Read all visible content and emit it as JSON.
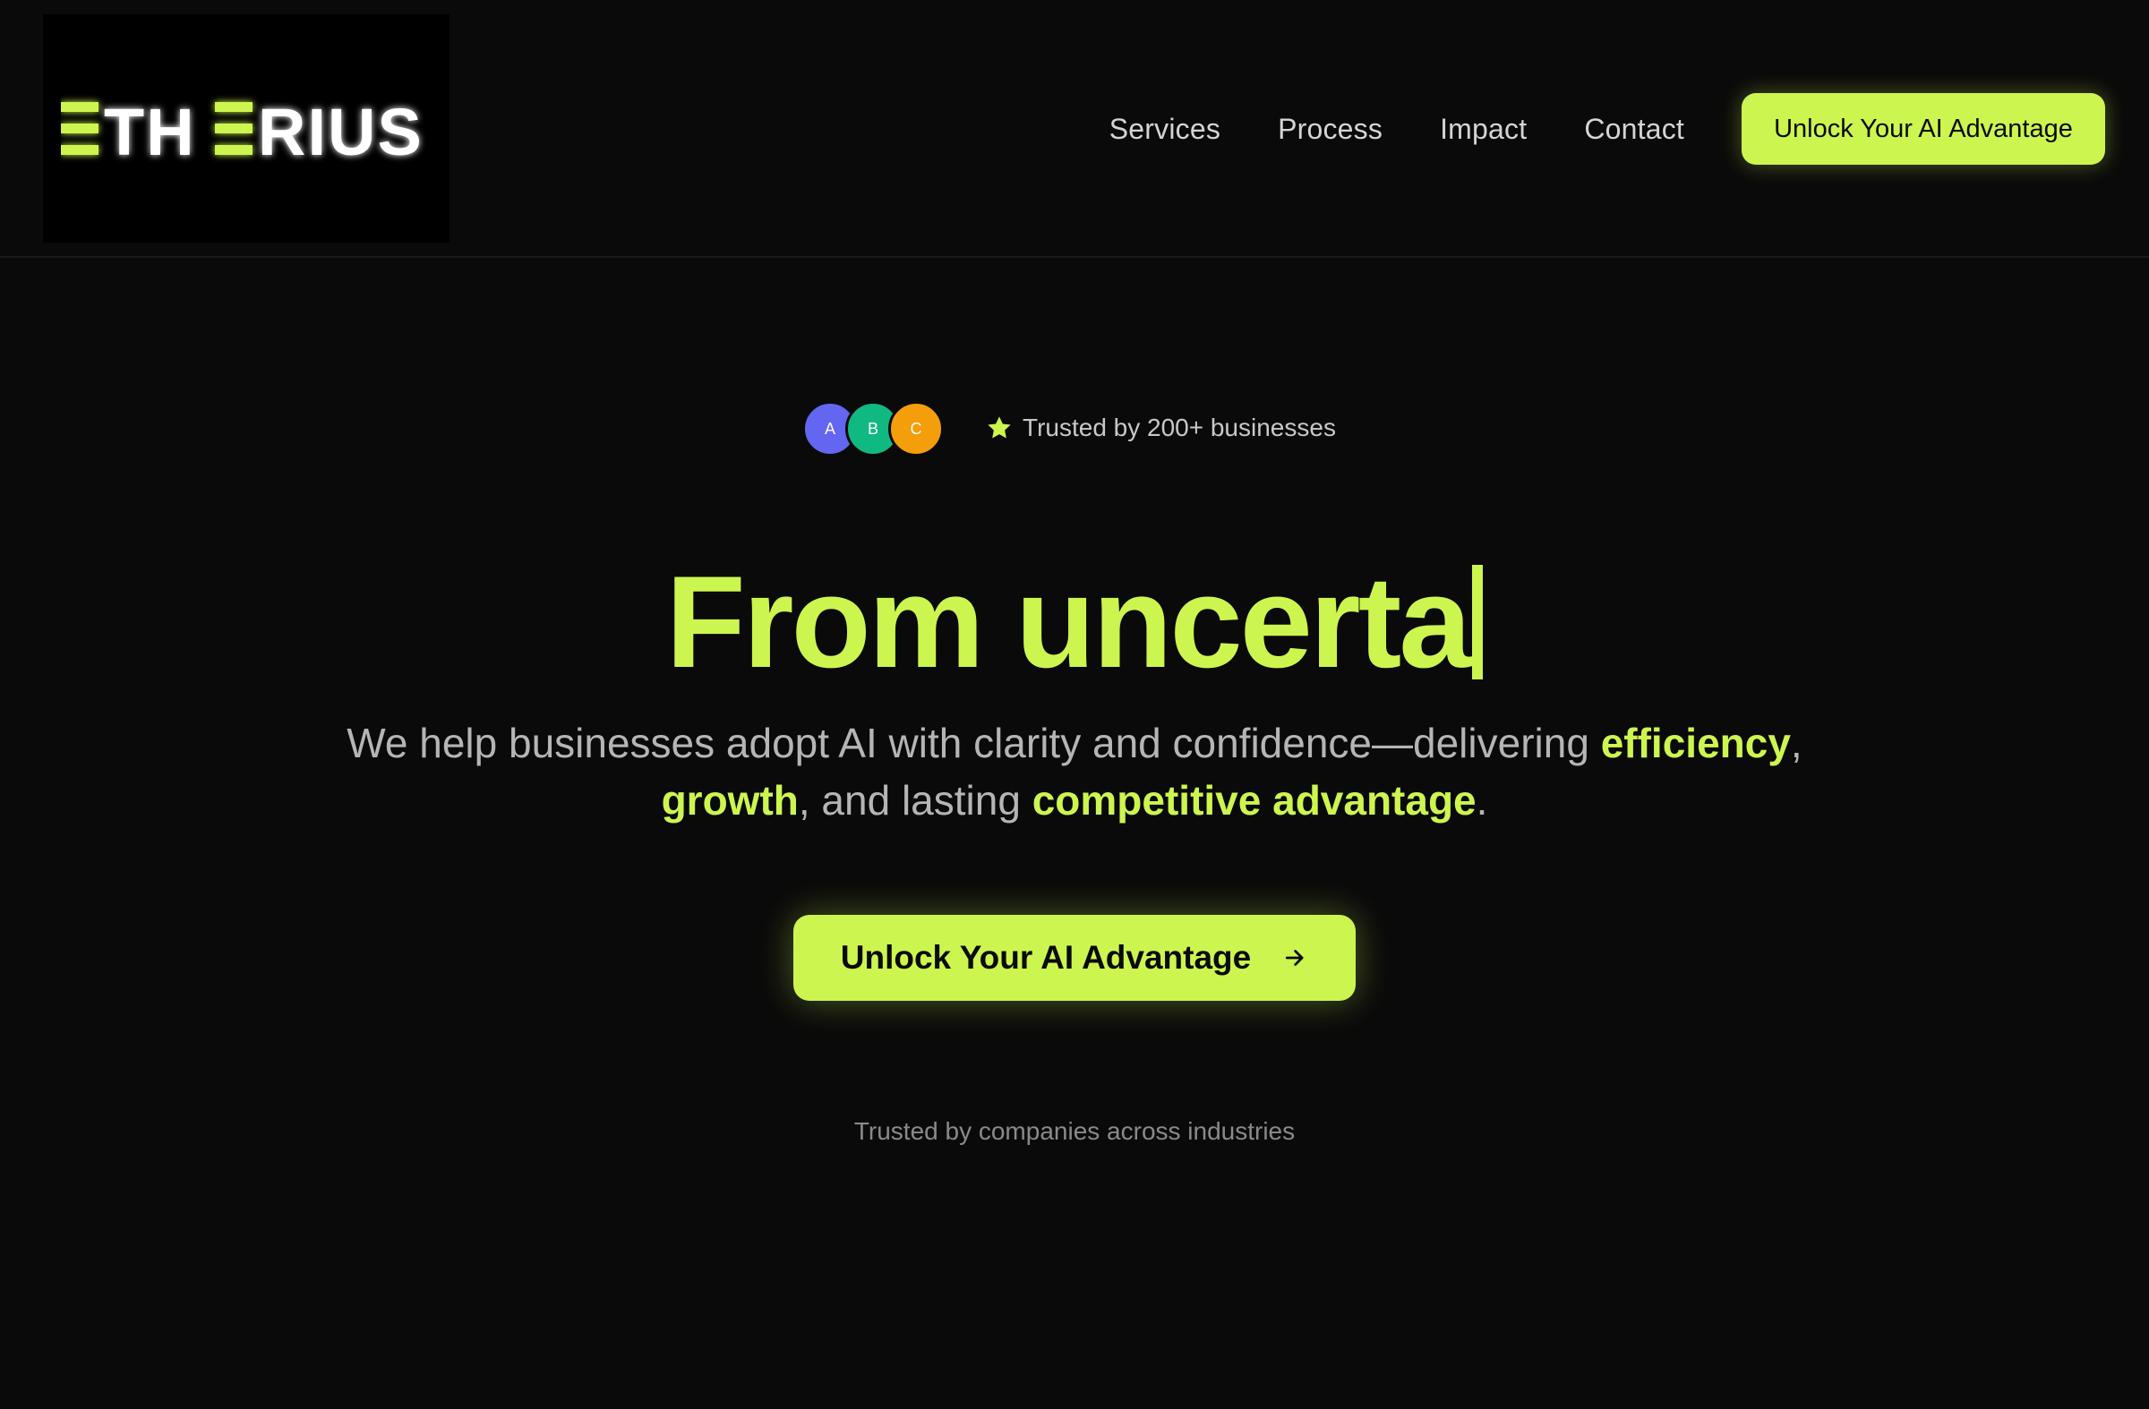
{
  "header": {
    "logo_text": "ETHERIUS",
    "nav": [
      {
        "label": "Services"
      },
      {
        "label": "Process"
      },
      {
        "label": "Impact"
      },
      {
        "label": "Contact"
      }
    ],
    "cta_label": "Unlock Your AI Advantage"
  },
  "hero": {
    "avatars": [
      {
        "initial": "A",
        "color": "#6366f1"
      },
      {
        "initial": "B",
        "color": "#10b981"
      },
      {
        "initial": "C",
        "color": "#f59e0b"
      }
    ],
    "trust_label": "Trusted by 200+ businesses",
    "headline": "From uncerta",
    "subtext": {
      "part1": "We help businesses adopt AI with clarity and confidence—delivering ",
      "hl1": "efficiency",
      "part2": ", ",
      "hl2": "growth",
      "part3": ", and lasting ",
      "hl3": "competitive advantage",
      "part4": "."
    },
    "cta_label": "Unlock Your AI Advantage",
    "companies_label": "Trusted by companies across industries"
  },
  "colors": {
    "accent": "#cdf54f",
    "background": "#0a0a0a"
  },
  "icons": {
    "star": "star-icon",
    "arrow": "arrow-right-icon"
  }
}
